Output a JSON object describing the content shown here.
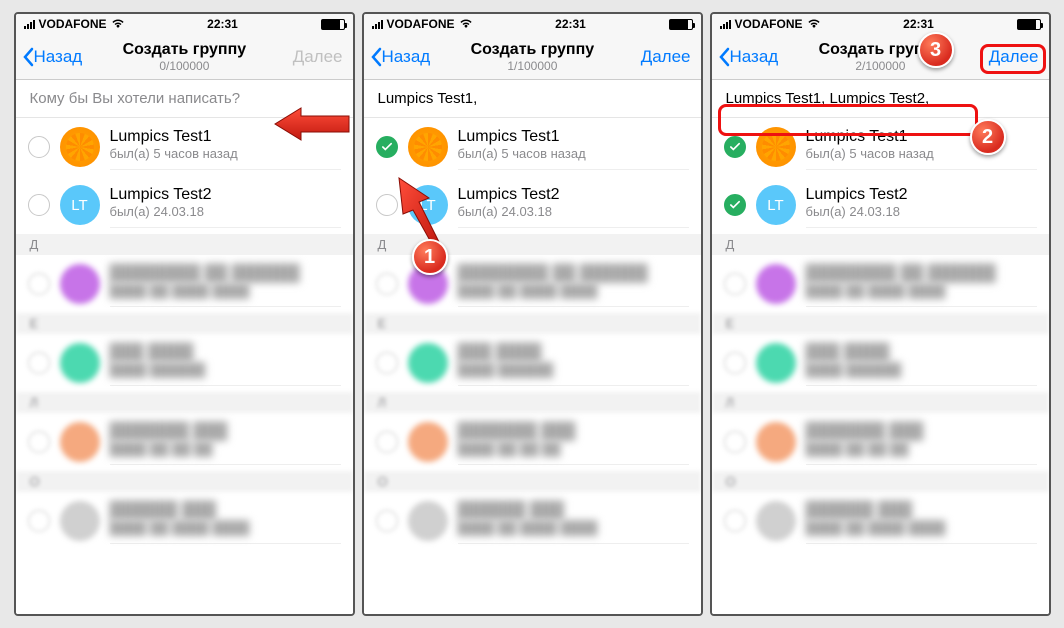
{
  "status": {
    "carrier": "VODAFONE",
    "time": "22:31"
  },
  "nav": {
    "back": "Назад",
    "title": "Создать группу",
    "next": "Далее"
  },
  "screens": [
    {
      "count": "0/100000",
      "search": "Кому бы Вы хотели написать?",
      "search_placeholder": true,
      "next_enabled": false,
      "selected": [
        false,
        false
      ]
    },
    {
      "count": "1/100000",
      "search": "Lumpics Test1,",
      "search_placeholder": false,
      "next_enabled": true,
      "selected": [
        true,
        false
      ]
    },
    {
      "count": "2/100000",
      "search": "Lumpics Test1,  Lumpics Test2,",
      "search_placeholder": false,
      "next_enabled": true,
      "selected": [
        true,
        true
      ]
    }
  ],
  "contacts": [
    {
      "name": "Lumpics Test1",
      "status": "был(а) 5 часов назад",
      "avatar_class": "orange",
      "initials": ""
    },
    {
      "name": "Lumpics Test2",
      "status": "был(а) 24.03.18",
      "avatar_class": "teal",
      "initials": "LT"
    }
  ],
  "section": "Д",
  "blurred_rows": [
    {
      "avatar_class": "purple"
    },
    {
      "avatar_class": "green"
    },
    {
      "avatar_class": "peach"
    },
    {
      "avatar_class": "gray"
    }
  ],
  "callouts": {
    "c1": "1",
    "c2": "2",
    "c3": "3"
  }
}
